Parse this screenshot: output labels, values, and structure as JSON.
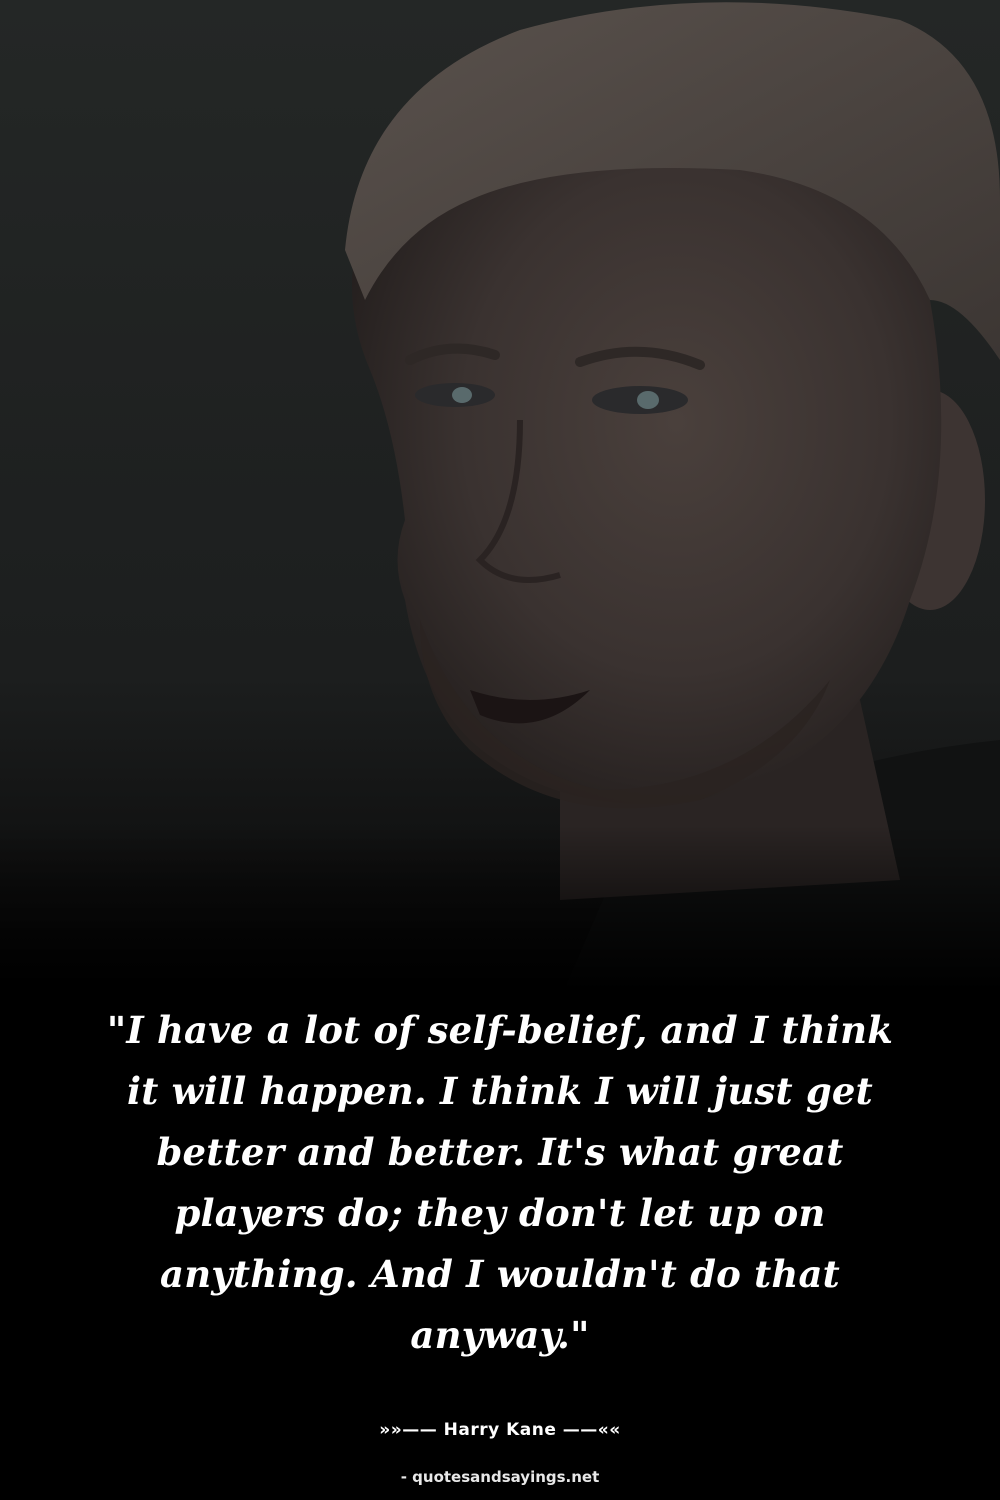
{
  "quote": {
    "text": "\"I have a lot of self-belief, and I think it will happen. I think I will just get better and better. It's what great players do; they don't let up on anything. And I wouldn't do that anyway.\""
  },
  "author": {
    "line": "»»—— Harry Kane ——««"
  },
  "watermark": {
    "text": "- quotesandsayings.net"
  },
  "colors": {
    "background_top": "#232525",
    "background_bottom": "#000000",
    "text": "#ffffff"
  }
}
